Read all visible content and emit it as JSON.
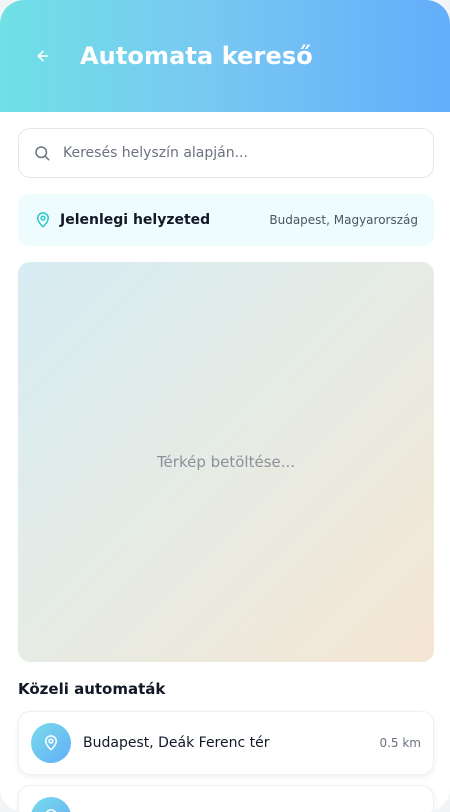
{
  "header": {
    "title": "Automata kereső"
  },
  "search": {
    "placeholder": "Keresés helyszín alapján..."
  },
  "current_location": {
    "label": "Jelenlegi helyzeted",
    "city": "Budapest, Magyarország"
  },
  "map": {
    "loading_text": "Térkép betöltése..."
  },
  "nearby": {
    "title": "Közeli automaták",
    "items": [
      {
        "name": "Budapest, Deák Ferenc tér",
        "distance": "0.5 km"
      },
      {
        "name": "",
        "distance": ""
      }
    ]
  },
  "icons": {
    "back": "arrow-left-icon",
    "search": "search-icon",
    "location": "map-pin-icon"
  },
  "colors": {
    "header_gradient_start": "#6fe0e6",
    "header_gradient_end": "#63adfb",
    "accent_teal": "#2dc7cf"
  }
}
